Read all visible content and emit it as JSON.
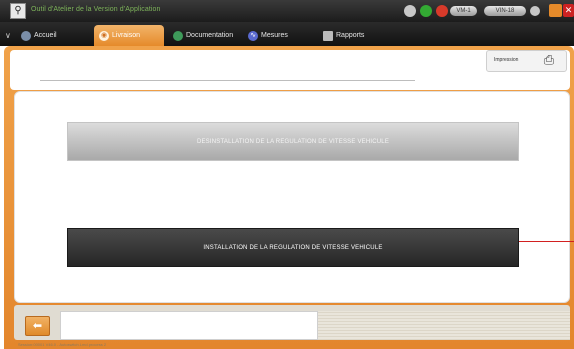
{
  "window": {
    "title": "Outil d'Atelier de la Version d'Application",
    "status_pill": "VM-1",
    "badge": "VIN-18",
    "accent_color": "#e8902f"
  },
  "tabs": [
    {
      "label": "Accueil",
      "icon": "home-icon",
      "active": false
    },
    {
      "label": "Livraison",
      "icon": "delivery-icon",
      "active": true
    },
    {
      "label": "Documentation",
      "icon": "book-icon",
      "active": false
    },
    {
      "label": "Mesures",
      "icon": "waveform-icon",
      "active": false
    },
    {
      "label": "Rapports",
      "icon": "report-icon",
      "active": false
    }
  ],
  "print": {
    "label": "Impression",
    "icon": "printer-icon"
  },
  "actions": {
    "uninstall_label": "DESINSTALLATION DE LA REGULATION DE VITESSE VEHICULE",
    "install_label": "INSTALLATION DE LA REGULATION DE VITESSE VEHICULE"
  },
  "bottom": {
    "back_icon": "arrow-left-icon",
    "message": "",
    "footer": "Session:00001 V46.0 - Autoswitch.Lmd.process 2"
  }
}
